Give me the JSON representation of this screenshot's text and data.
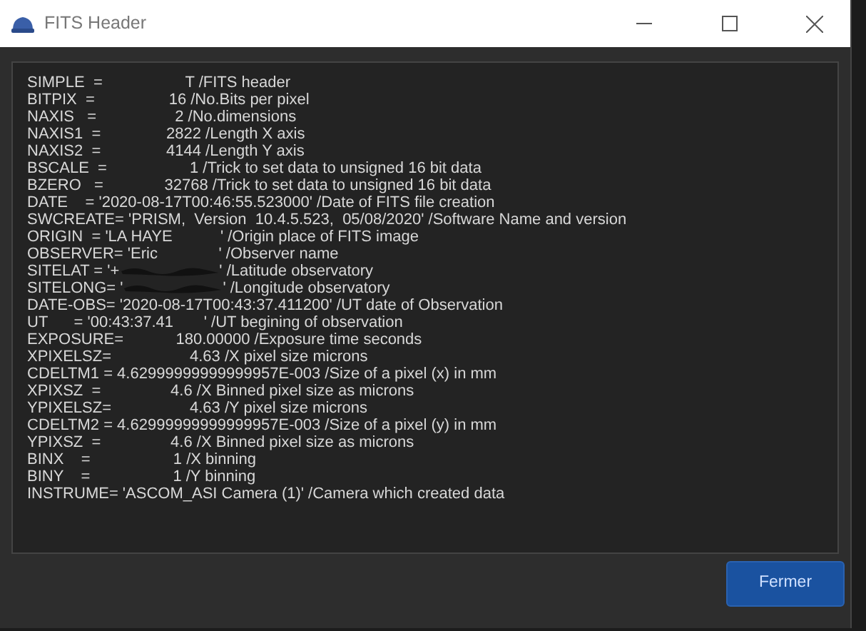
{
  "window": {
    "title": "FITS Header"
  },
  "header_lines": [
    {
      "kind": "plain",
      "text": "SIMPLE  =                   T /FITS header"
    },
    {
      "kind": "plain",
      "text": "BITPIX  =                 16 /No.Bits per pixel"
    },
    {
      "kind": "plain",
      "text": "NAXIS   =                  2 /No.dimensions"
    },
    {
      "kind": "plain",
      "text": "NAXIS1  =               2822 /Length X axis"
    },
    {
      "kind": "plain",
      "text": "NAXIS2  =               4144 /Length Y axis"
    },
    {
      "kind": "plain",
      "text": "BSCALE  =                   1 /Trick to set data to unsigned 16 bit data"
    },
    {
      "kind": "plain",
      "text": "BZERO   =              32768 /Trick to set data to unsigned 16 bit data"
    },
    {
      "kind": "plain",
      "text": "DATE    = '2020-08-17T00:46:55.523000' /Date of FITS file creation"
    },
    {
      "kind": "plain",
      "text": "SWCREATE= 'PRISM,  Version  10.4.5.523,  05/08/2020' /Software Name and version"
    },
    {
      "kind": "plain",
      "text": "ORIGIN  = 'LA HAYE           ' /Origin place of FITS image"
    },
    {
      "kind": "plain",
      "text": "OBSERVER= 'Eric              ' /Observer name"
    },
    {
      "kind": "redacted",
      "before": "SITELAT = '+",
      "after": "' /Latitude observatory"
    },
    {
      "kind": "redacted",
      "before": "SITELONG= '",
      "after": "' /Longitude observatory"
    },
    {
      "kind": "plain",
      "text": "DATE-OBS= '2020-08-17T00:43:37.411200' /UT date of Observation"
    },
    {
      "kind": "plain",
      "text": "UT      = '00:43:37.41       ' /UT begining of observation"
    },
    {
      "kind": "plain",
      "text": "EXPOSURE=            180.00000 /Exposure time seconds"
    },
    {
      "kind": "plain",
      "text": "XPIXELSZ=                  4.63 /X pixel size microns"
    },
    {
      "kind": "plain",
      "text": "CDELTM1 = 4.62999999999999957E-003 /Size of a pixel (x) in mm"
    },
    {
      "kind": "plain",
      "text": "XPIXSZ  =                4.6 /X Binned pixel size as microns"
    },
    {
      "kind": "plain",
      "text": "YPIXELSZ=                  4.63 /Y pixel size microns"
    },
    {
      "kind": "plain",
      "text": "CDELTM2 = 4.62999999999999957E-003 /Size of a pixel (y) in mm"
    },
    {
      "kind": "plain",
      "text": "YPIXSZ  =                4.6 /X Binned pixel size as microns"
    },
    {
      "kind": "plain",
      "text": "BINX    =                   1 /X binning"
    },
    {
      "kind": "plain",
      "text": "BINY    =                   1 /Y binning"
    },
    {
      "kind": "plain",
      "text": "INSTRUME= 'ASCOM_ASI Camera (1)' /Camera which created data"
    }
  ],
  "buttons": [
    "Fermer"
  ]
}
